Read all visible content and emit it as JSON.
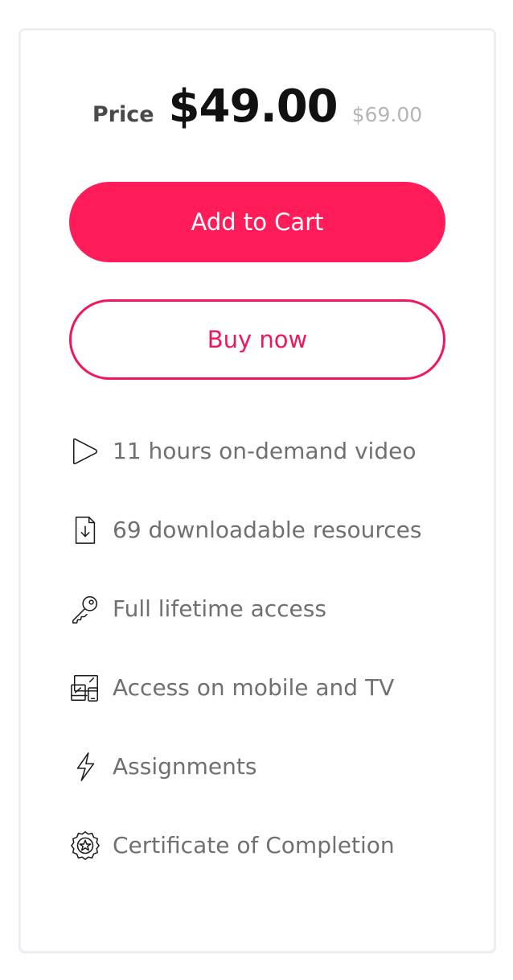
{
  "pricing": {
    "label": "Price",
    "current": "$49.00",
    "original": "$69.00"
  },
  "actions": {
    "add_to_cart": "Add to Cart",
    "buy_now": "Buy now"
  },
  "features": [
    {
      "icon": "play-icon",
      "text": "11 hours on-demand video"
    },
    {
      "icon": "download-file-icon",
      "text": "69 downloadable resources"
    },
    {
      "icon": "key-icon",
      "text": "Full lifetime access"
    },
    {
      "icon": "devices-icon",
      "text": "Access on mobile and TV"
    },
    {
      "icon": "lightning-icon",
      "text": "Assignments"
    },
    {
      "icon": "certificate-icon",
      "text": "Certificate of Completion"
    }
  ],
  "colors": {
    "accent": "#ff1c59",
    "accent_border": "#f2175a",
    "text_muted": "#707070",
    "price_old": "#b5b5b5",
    "card_border": "#ededf3"
  }
}
